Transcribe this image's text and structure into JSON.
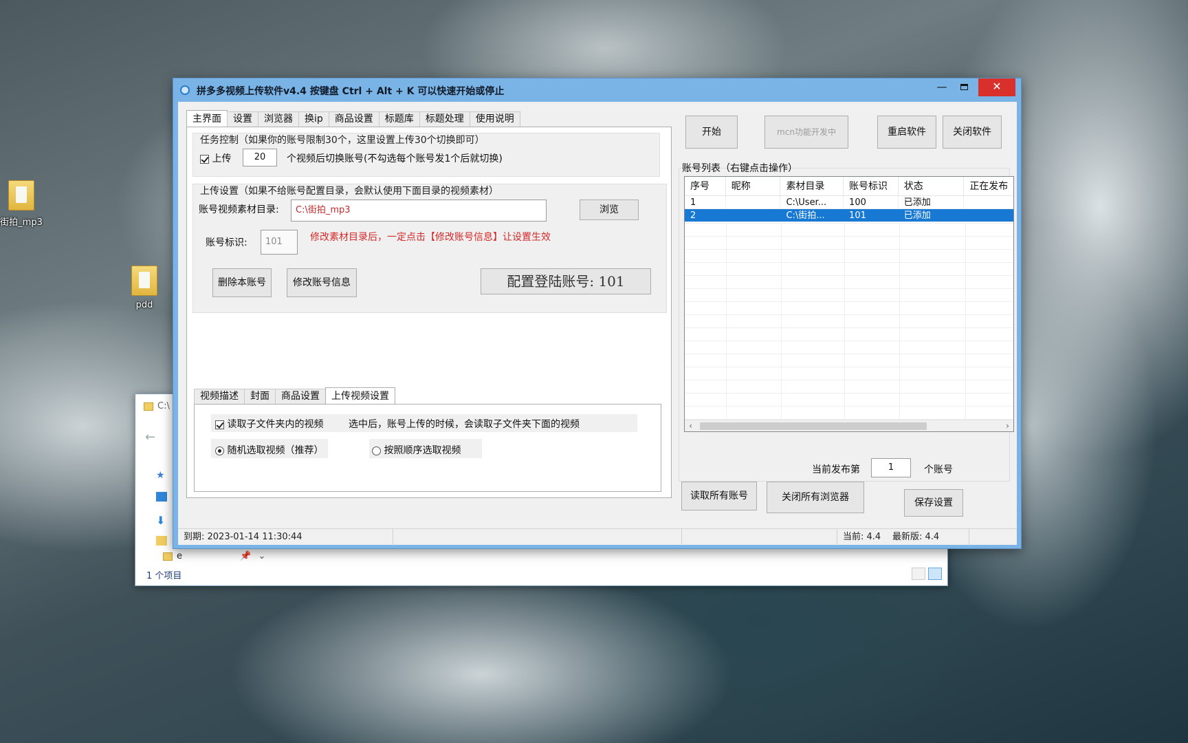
{
  "desktop": {
    "icons": [
      {
        "label": "街拍_mp3"
      },
      {
        "label": "pdd"
      }
    ]
  },
  "explorer": {
    "title": "C:\\",
    "status": "1 个项目",
    "row_label": "e"
  },
  "app": {
    "title": "拼多多视频上传软件v4.4    按键盘 Ctrl + Alt + K  可以快速开始或停止",
    "window_controls": {
      "minimize": "—",
      "close": "✕"
    },
    "tabs": [
      "主界面",
      "设置",
      "浏览器",
      "换ip",
      "商品设置",
      "标题库",
      "标题处理",
      "使用说明"
    ],
    "task_control": {
      "title": "任务控制（如果你的账号限制30个，这里设置上传30个切换即可）",
      "upload_checkbox_label": "上传",
      "upload_count": "20",
      "switch_text": "个视频后切换账号(不勾选每个账号发1个后就切换)"
    },
    "upload_settings": {
      "title": "上传设置（如果不给账号配置目录，会默认使用下面目录的视频素材）",
      "dir_label": "账号视频素材目录:",
      "dir_value": "C:\\街拍_mp3",
      "browse_button": "浏览",
      "account_id_label": "账号标识:",
      "account_id_value": "101",
      "warning": "修改素材目录后，一定点击【修改账号信息】让设置生效",
      "delete_button": "删除本账号",
      "modify_button": "修改账号信息",
      "config_label": "配置登陆账号:  101"
    },
    "subtabs": [
      "视频描述",
      "封面",
      "商品设置",
      "上传视频设置"
    ],
    "upload_video_settings": {
      "read_subfolder_label": "读取子文件夹内的视频",
      "read_subfolder_hint": "选中后，账号上传的时候，会读取子文件夹下面的视频",
      "random_label": "随机选取视频（推荐）",
      "ordered_label": "按照顺序选取视频"
    },
    "buttons": {
      "start": "开始",
      "mcn": "mcn功能开发中",
      "restart": "重启软件",
      "close_app": "关闭软件",
      "read_all": "读取所有账号",
      "close_browsers": "关闭所有浏览器",
      "save": "保存设置"
    },
    "account_list": {
      "title": "账号列表（右键点击操作）",
      "columns": [
        "序号",
        "昵称",
        "素材目录",
        "账号标识",
        "状态",
        "正在发布"
      ],
      "rows": [
        {
          "index": "1",
          "nickname": "",
          "dir": "C:\\User...",
          "id": "100",
          "status": "已添加",
          "publishing": ""
        },
        {
          "index": "2",
          "nickname": "",
          "dir": "C:\\街拍...",
          "id": "101",
          "status": "已添加",
          "publishing": ""
        }
      ],
      "selected_row": 2
    },
    "publish_counter": {
      "prefix": "当前发布第",
      "value": "1",
      "suffix": "个账号"
    },
    "statusbar": {
      "expiry": "到期: 2023-01-14 11:30:44",
      "current_version": "当前: 4.4",
      "latest_version": "最新版: 4.4"
    },
    "colors": {
      "titlebar": "#7ab3e5",
      "close_button": "#d9302c",
      "selection": "#1779d3",
      "warning_text": "#d42a2a"
    }
  }
}
